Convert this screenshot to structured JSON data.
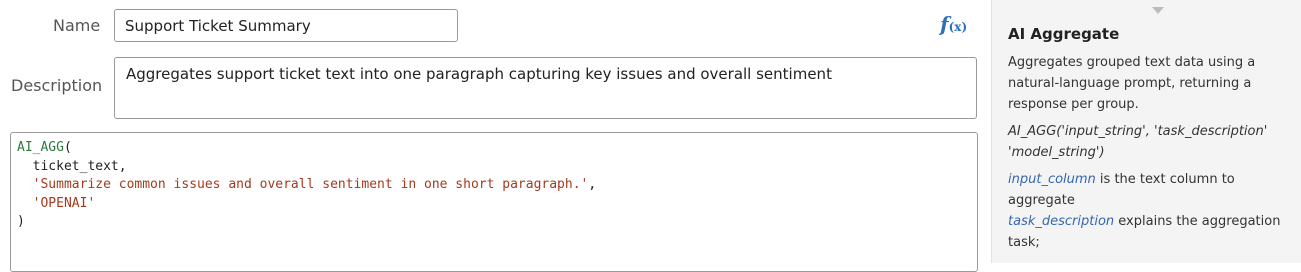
{
  "form": {
    "name_label": "Name",
    "name_value": "Support Ticket Summary",
    "description_label": "Description",
    "description_value": "Aggregates support ticket text into one paragraph capturing key issues and overall sentiment"
  },
  "formula_button": {
    "symbol": "f",
    "suffix": "(x)",
    "icon": "function-icon"
  },
  "editor": {
    "lines": [
      {
        "fn": "AI_AGG",
        "punc": "("
      },
      {
        "indent": "  ",
        "id": "ticket_text",
        "punc": ","
      },
      {
        "indent": "  ",
        "str": "'Summarize common issues and overall sentiment in one short paragraph.'",
        "punc": ","
      },
      {
        "indent": "  ",
        "str": "'OPENAI'"
      },
      {
        "punc": ")"
      }
    ]
  },
  "help": {
    "title": "AI Aggregate",
    "description": "Aggregates grouped text data using a natural-language prompt, returning a response per group.",
    "signature": "AI_AGG('input_string', 'task_description' 'model_string')",
    "param1_name": "input_column",
    "param1_text": " is the text column to aggregate",
    "param2_name": "task_description",
    "param2_text": " explains the aggregation task;"
  },
  "colors": {
    "function": "#2a7a3e",
    "string": "#a43a1e",
    "accent": "#2e6fb8",
    "param": "#3567b0"
  }
}
